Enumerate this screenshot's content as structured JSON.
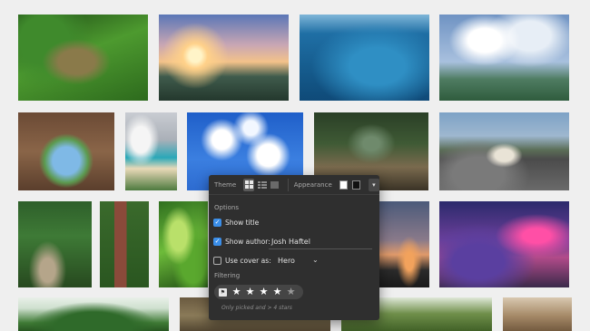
{
  "popover": {
    "theme_label": "Theme",
    "appearance_label": "Appearance",
    "options_label": "Options",
    "show_title_label": "Show title",
    "show_author_label": "Show author:",
    "author_value": "Josh Haftel",
    "use_cover_label": "Use cover as:",
    "cover_value": "Hero",
    "filtering_label": "Filtering",
    "filter_hint": "Only picked and > 4 stars",
    "star_rating": 4,
    "star_max": 5,
    "show_title_checked": true,
    "show_author_checked": true,
    "use_cover_checked": false,
    "accent_color": "#3b8ee8"
  },
  "icons": {
    "theme_grid": "grid-layout-icon",
    "theme_rows": "rows-layout-icon",
    "theme_single": "single-layout-icon",
    "appearance_light": "white-swatch-icon",
    "appearance_dark": "black-swatch-icon",
    "collapse": "chevron-down-icon",
    "pick_flag": "pick-flag-icon",
    "star": "star-icon"
  }
}
